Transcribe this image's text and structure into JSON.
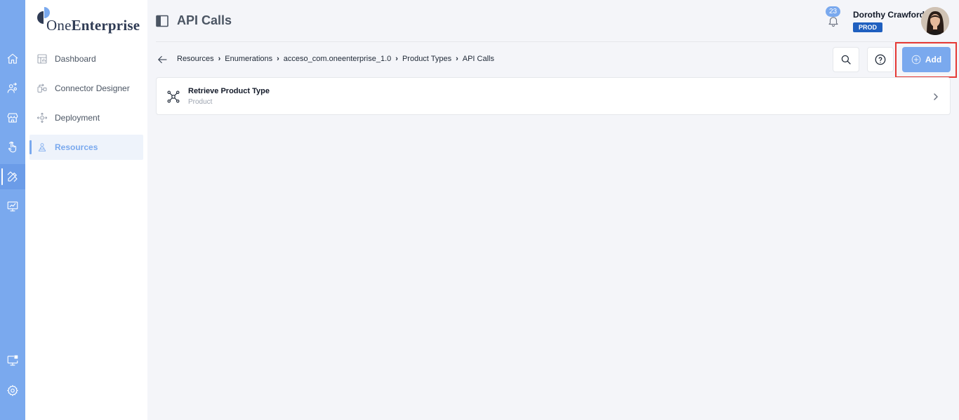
{
  "app": {
    "brand_prefix": "One",
    "brand_suffix": "Enterprise",
    "accent_color": "#7aa9ee"
  },
  "rail": {
    "items": [
      {
        "name": "home",
        "icon": "home-icon"
      },
      {
        "name": "users",
        "icon": "user-switch-icon"
      },
      {
        "name": "store",
        "icon": "store-icon"
      },
      {
        "name": "touch",
        "icon": "hand-pointer-icon"
      },
      {
        "name": "tools",
        "icon": "pencil-ruler-icon",
        "active": true
      },
      {
        "name": "monitor",
        "icon": "monitor-chart-icon"
      },
      {
        "name": "monitor-apps",
        "icon": "monitor-grid-icon"
      },
      {
        "name": "settings",
        "icon": "gear-icon"
      }
    ]
  },
  "sidebar": {
    "items": [
      {
        "label": "Dashboard",
        "icon": "dashboard-icon"
      },
      {
        "label": "Connector Designer",
        "icon": "connector-icon"
      },
      {
        "label": "Deployment",
        "icon": "deployment-icon"
      },
      {
        "label": "Resources",
        "icon": "resources-icon",
        "active": true
      }
    ]
  },
  "header": {
    "title": "API Calls",
    "notifications_count": "23",
    "user_name": "Dorothy Crawford",
    "environment": "PROD"
  },
  "breadcrumb": {
    "items": [
      "Resources",
      "Enumerations",
      "acceso_com.oneenterprise_1.0",
      "Product Types",
      "API Calls"
    ]
  },
  "toolbar": {
    "add_label": "Add",
    "search_icon": "search-icon",
    "help_icon": "help-icon"
  },
  "list": {
    "items": [
      {
        "title": "Retrieve Product Type",
        "subtitle": "Product",
        "icon": "api-network-icon"
      }
    ]
  }
}
